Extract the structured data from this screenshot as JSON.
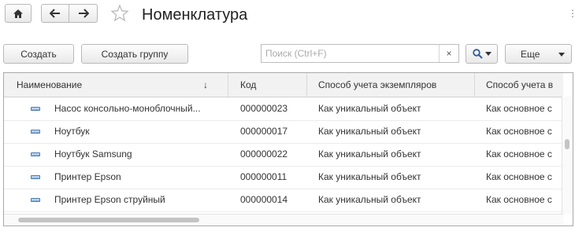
{
  "window": {
    "title": "Номенклатура",
    "icons": {
      "home": "home-icon",
      "back": "arrow-left-icon",
      "forward": "arrow-right-icon",
      "favorite": "star-icon",
      "more": "vertical-dots-icon"
    }
  },
  "toolbar": {
    "create_label": "Создать",
    "create_group_label": "Создать группу",
    "search_placeholder": "Поиск (Ctrl+F)",
    "search_clear": "×",
    "more_label": "Еще"
  },
  "table": {
    "columns": [
      "Наименование",
      "Код",
      "Способ учета экземпляров",
      "Способ учета в"
    ],
    "sort_indicator": "↓",
    "rows": [
      {
        "name": "Насос консольно-моноблочный...",
        "code": "000000023",
        "method": "Как уникальный объект",
        "method2": "Как основное с"
      },
      {
        "name": "Ноутбук",
        "code": "000000017",
        "method": "Как уникальный объект",
        "method2": "Как основное с"
      },
      {
        "name": "Ноутбук Samsung",
        "code": "000000022",
        "method": "Как уникальный объект",
        "method2": "Как основное с"
      },
      {
        "name": "Принтер Epson",
        "code": "000000011",
        "method": "Как уникальный объект",
        "method2": "Как основное с"
      },
      {
        "name": "Принтер Epson струйный",
        "code": "000000014",
        "method": "Как уникальный объект",
        "method2": "Как основное с"
      }
    ]
  }
}
